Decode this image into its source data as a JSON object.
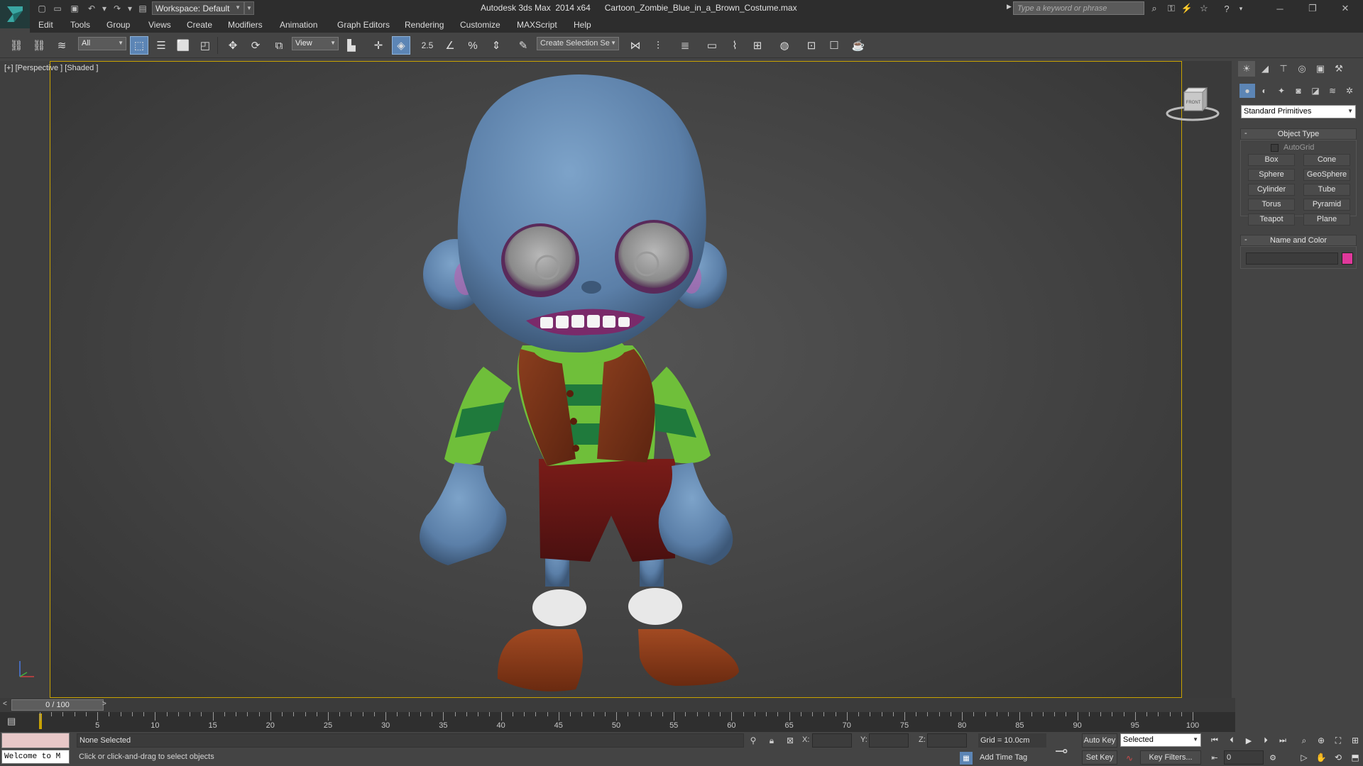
{
  "titlebar": {
    "workspace_label": "Workspace: Default",
    "title": "Autodesk 3ds Max  2014 x64      Cartoon_Zombie_Blue_in_a_Brown_Costume.max",
    "search_placeholder": "Type a keyword or phrase"
  },
  "menubar": {
    "items": [
      "Edit",
      "Tools",
      "Group",
      "Views",
      "Create",
      "Modifiers",
      "Animation",
      "Graph Editors",
      "Rendering",
      "Customize",
      "MAXScript",
      "Help"
    ]
  },
  "toolbar": {
    "selection_filter": "All",
    "ref_coord": "View",
    "snap_angle_label": "2.5",
    "named_selection_placeholder": "Create Selection Se"
  },
  "viewport": {
    "label": "[+] [Perspective ] [Shaded ]",
    "viewcube_face": "FRONT"
  },
  "command_panel": {
    "category": "Standard Primitives",
    "object_type_title": "Object Type",
    "autogrid_label": "AutoGrid",
    "primitives": [
      "Box",
      "Cone",
      "Sphere",
      "GeoSphere",
      "Cylinder",
      "Tube",
      "Torus",
      "Pyramid",
      "Teapot",
      "Plane"
    ],
    "name_color_title": "Name and Color",
    "object_color": "#e0389b"
  },
  "timeline": {
    "slider_label": "0 / 100",
    "ticks": [
      "5",
      "10",
      "15",
      "20",
      "25",
      "30",
      "35",
      "40",
      "45",
      "50",
      "55",
      "60",
      "65",
      "70",
      "75",
      "80",
      "85",
      "90",
      "95",
      "100"
    ]
  },
  "statusbar": {
    "maxscript_output": "Welcome to M",
    "selection_status": "None Selected",
    "prompt": "Click or click-and-drag to select objects",
    "x_label": "X:",
    "y_label": "Y:",
    "z_label": "Z:",
    "grid": "Grid = 10.0cm",
    "add_time_tag": "Add Time Tag",
    "auto_key": "Auto Key",
    "set_key": "Set Key",
    "selected_mode": "Selected",
    "key_filters": "Key Filters...",
    "current_frame": "0"
  }
}
